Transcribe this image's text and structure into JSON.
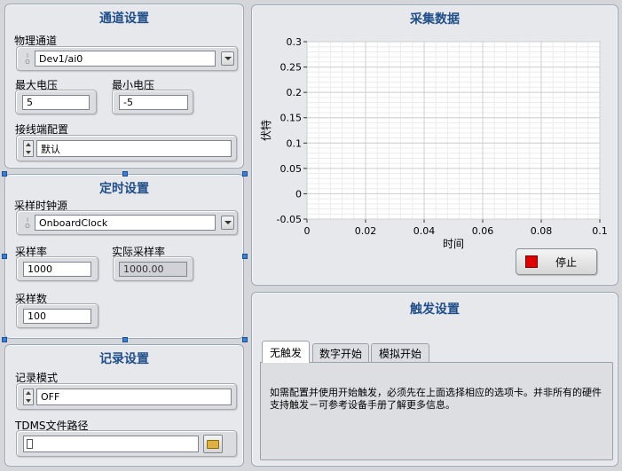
{
  "channel": {
    "title": "通道设置",
    "physical_channel_label": "物理通道",
    "physical_channel_value": "Dev1/ai0",
    "max_voltage_label": "最大电压",
    "max_voltage_value": "5",
    "min_voltage_label": "最小电压",
    "min_voltage_value": "-5",
    "terminal_config_label": "接线端配置",
    "terminal_config_value": "默认"
  },
  "timing": {
    "title": "定时设置",
    "clock_source_label": "采样时钟源",
    "clock_source_value": "OnboardClock",
    "rate_label": "采样率",
    "rate_value": "1000",
    "actual_rate_label": "实际采样率",
    "actual_rate_value": "1000.00",
    "samples_label": "采样数",
    "samples_value": "100"
  },
  "logging": {
    "title": "记录设置",
    "mode_label": "记录模式",
    "mode_value": "OFF",
    "path_label": "TDMS文件路径",
    "path_value": ""
  },
  "acquire": {
    "title": "采集数据",
    "stop_label": "停止",
    "stop_color": "#e00000"
  },
  "chart_data": {
    "type": "line",
    "title": "",
    "xlabel": "时间",
    "ylabel": "伏特",
    "xlim": [
      0,
      0.1
    ],
    "ylim": [
      -0.05,
      0.3
    ],
    "x_ticks": [
      "0",
      "0.02",
      "0.04",
      "0.06",
      "0.08",
      "0.1"
    ],
    "y_ticks": [
      "-0.05",
      "0",
      "0.05",
      "0.1",
      "0.15",
      "0.2",
      "0.25",
      "0.3"
    ],
    "grid": true,
    "series": []
  },
  "trigger": {
    "title": "触发设置",
    "tabs": [
      {
        "label": "无触发",
        "active": true
      },
      {
        "label": "数字开始",
        "active": false
      },
      {
        "label": "模拟开始",
        "active": false
      }
    ],
    "message": "如需配置并使用开始触发，必须先在上面选择相应的选项卡。并非所有的硬件支持触发－可参考设备手册了解更多信息。"
  },
  "icons": {
    "io": "I/O",
    "path": "path-icon",
    "folder": "folder-icon"
  }
}
